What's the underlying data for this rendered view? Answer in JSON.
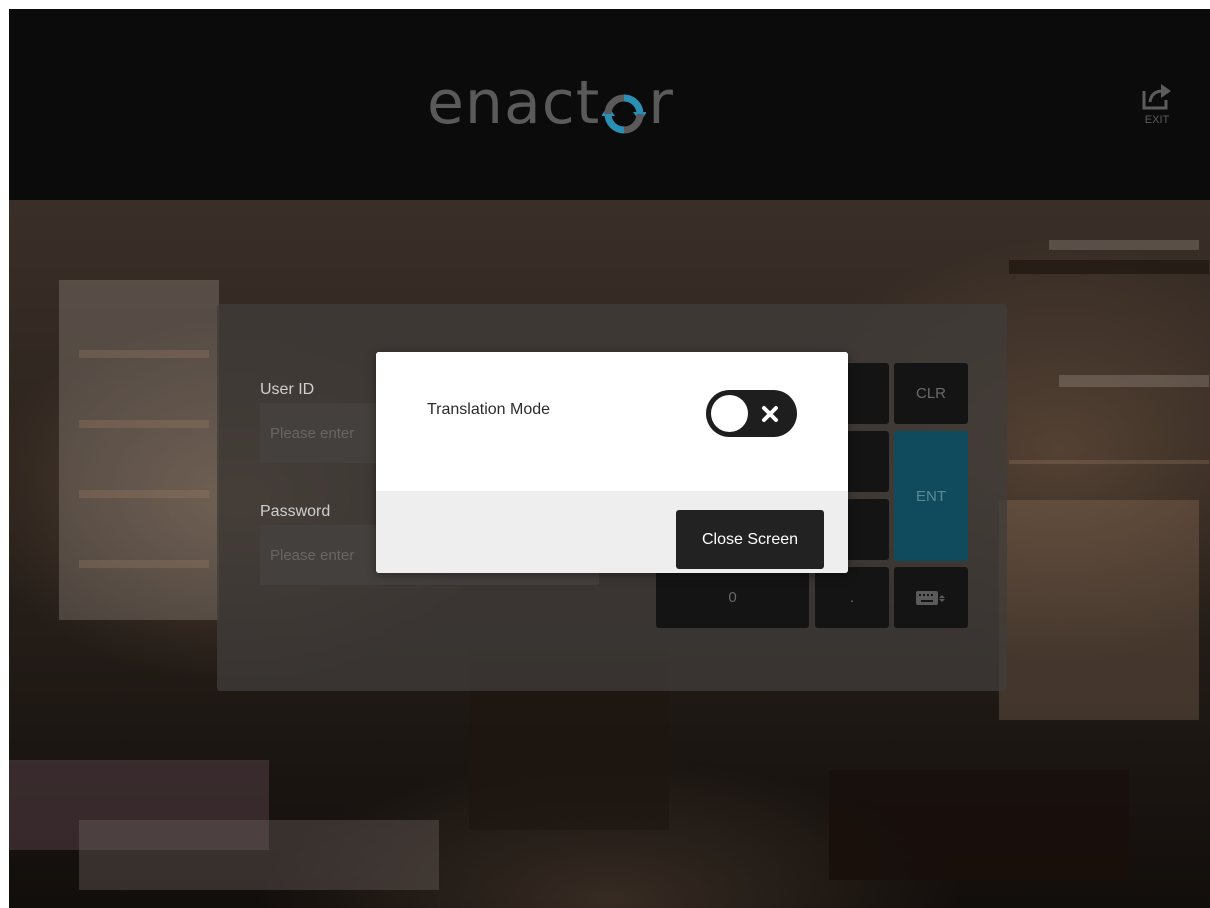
{
  "header": {
    "logo": {
      "part1": "enact",
      "part2": "r"
    },
    "exit_label": "EXIT"
  },
  "login": {
    "user_id_label": "User ID",
    "user_id_placeholder": "Please enter",
    "password_label": "Password",
    "password_placeholder": "Please enter"
  },
  "keypad": {
    "clear_label": "CLR",
    "enter_label": "ENT",
    "zero_label": "0",
    "decimal_label": "."
  },
  "dialog": {
    "translation_mode_label": "Translation Mode",
    "translation_mode_on": false,
    "close_button_label": "Close Screen"
  },
  "colors": {
    "logo_text": "#5a5a5a",
    "logo_accent": "#2a8fb3",
    "enter_key": "#0f4b5c",
    "toggle_track": "#1e1e1e",
    "dialog_button": "#222222"
  },
  "icons": {
    "exit": "exit-share-icon",
    "keyboard": "keyboard-icon",
    "toggle_off": "close-x-icon"
  }
}
